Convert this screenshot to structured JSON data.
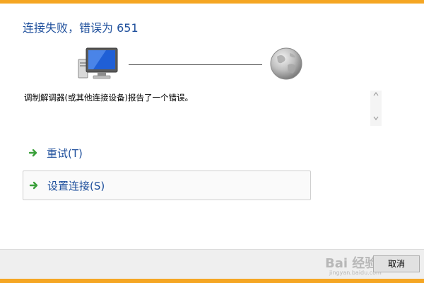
{
  "dialog": {
    "title": "连接失败，错误为 651",
    "message": "调制解调器(或其他连接设备)报告了一个错误。"
  },
  "icons": {
    "local": "computer-monitor-icon",
    "remote": "globe-icon"
  },
  "options": {
    "retry_label": "重试(T)",
    "setup_label": "设置连接(S)"
  },
  "footer": {
    "cancel_label": "取消",
    "watermark_text": "Bai 经验",
    "watermark_sub": "jingyan.baidu.com"
  },
  "colors": {
    "accent": "#f5a623",
    "link": "#1e4f9c",
    "arrow": "#3aa03a"
  }
}
